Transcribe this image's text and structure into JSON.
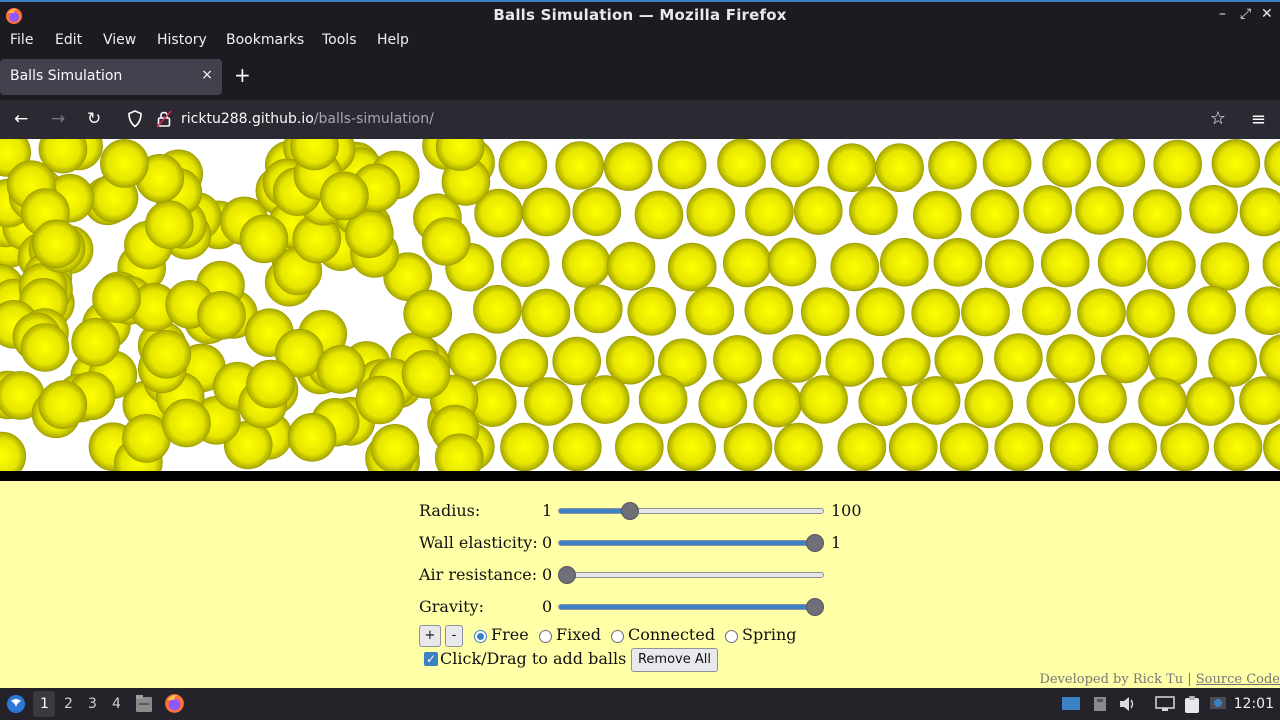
{
  "window": {
    "title": "Balls Simulation — Mozilla Firefox",
    "controls": [
      "–",
      "⤢",
      "✕"
    ]
  },
  "menubar": {
    "items": [
      "File",
      "Edit",
      "View",
      "History",
      "Bookmarks",
      "Tools",
      "Help"
    ]
  },
  "tabs": [
    {
      "title": "Balls Simulation",
      "close": "×",
      "active": true
    }
  ],
  "newtab": "+",
  "nav": {
    "back": "←",
    "forward": "→",
    "reload": "↻",
    "url_host": "ricktu288.github.io",
    "url_path": "/balls-simulation/",
    "star": "☆",
    "menu": "≡"
  },
  "simulation": {
    "ball_color": "#e6e600",
    "background": "#ffffff",
    "page_background": "#ffffa8"
  },
  "controls": {
    "radius": {
      "label": "Radius:",
      "min_label": "1",
      "max_label": "100",
      "value_fraction": 0.27
    },
    "wall_elasticity": {
      "label": "Wall elasticity:",
      "min_label": "0",
      "max_label": "1",
      "value_fraction": 0.97
    },
    "air_resistance": {
      "label": "Air resistance:",
      "min_label": "0",
      "value_fraction": 0.03
    },
    "gravity": {
      "label": "Gravity:",
      "min_label": "0",
      "value_fraction": 0.97
    },
    "add_button": "+",
    "remove_button": "-",
    "modes": [
      {
        "label": "Free",
        "selected": true
      },
      {
        "label": "Fixed",
        "selected": false
      },
      {
        "label": "Connected",
        "selected": false
      },
      {
        "label": "Spring",
        "selected": false
      }
    ],
    "click_drag_label": "Click/Drag to add balls",
    "click_drag_checked": true,
    "remove_all": "Remove All"
  },
  "credit": {
    "text": "Developed by Rick Tu",
    "separator": " | ",
    "link": "Source Code"
  },
  "taskbar": {
    "workspaces": [
      "1",
      "2",
      "3",
      "4"
    ],
    "active_workspace": "1",
    "clock": "12:01"
  },
  "accent_color": "#3b82c4"
}
